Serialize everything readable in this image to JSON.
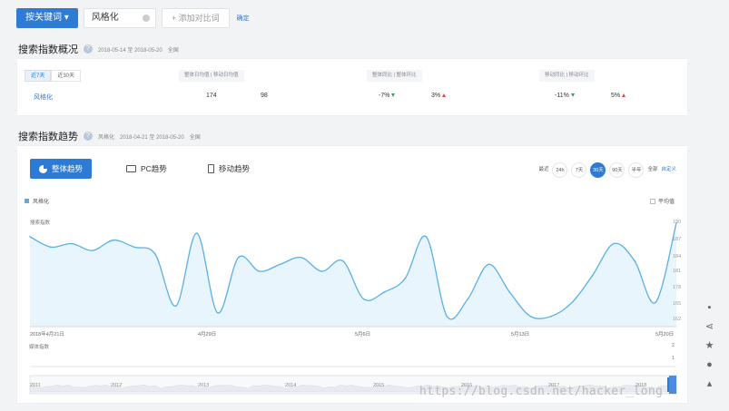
{
  "search_bar": {
    "keyword_button": "按关键词",
    "keyword_value": "风格化",
    "add_compare": "添加对比词",
    "confirm": "确定"
  },
  "overview": {
    "title": "搜索指数概况",
    "date_range": "2018-05-14 至 2018-05-20",
    "region": "全国",
    "tabs": [
      "近7天",
      "近30天"
    ],
    "headers": {
      "col1": "整体日均值  |  移动日均值",
      "col2": "整体同比  |  整体环比",
      "col3": "移动同比  |  移动环比"
    },
    "keyword": "风格化",
    "overall_daily_avg": "174",
    "mobile_daily_avg": "98",
    "overall_yoy": "-7%",
    "overall_mom": "3%",
    "mobile_yoy": "-11%",
    "mobile_mom": "5%"
  },
  "trend": {
    "title": "搜索指数趋势",
    "keyword": "风格化",
    "date_range": "2018-04-21 至 2018-05-20",
    "region": "全国",
    "tabs": [
      "整体趋势",
      "PC趋势",
      "移动趋势"
    ],
    "ranges": [
      "最近",
      "24h",
      "7天",
      "30天",
      "90天",
      "半年",
      "全部",
      "自定义"
    ],
    "active_range": "30天",
    "legend": "风格化",
    "avg_label": "平均值",
    "y_caption": "搜索指数",
    "media_caption": "媒体指数",
    "media_ticks": [
      "2",
      "1"
    ]
  },
  "chart_data": {
    "type": "area",
    "title": "",
    "xlabel": "",
    "ylabel": "搜索指数",
    "x_tick_labels": [
      "2018年4月21日",
      "4月29日",
      "5月6日",
      "5月13日",
      "5月20日"
    ],
    "y_tick_labels": [
      "190",
      "187",
      "184",
      "181",
      "178",
      "165",
      "162"
    ],
    "series": [
      {
        "name": "风格化",
        "values": [
          186,
          183,
          184,
          182,
          185,
          183,
          181,
          166,
          187,
          164,
          180,
          176,
          178,
          180,
          176,
          179,
          168,
          170,
          174,
          186,
          163,
          168,
          178,
          170,
          163,
          163,
          167,
          175,
          184,
          179,
          167,
          190
        ]
      }
    ],
    "brush_years": [
      "2011",
      "2012",
      "2013",
      "2014",
      "2015",
      "2016",
      "2017",
      "2018"
    ],
    "colors": {
      "line": "#5ab0e4",
      "fill": "#e9f5fc",
      "accent": "#2e7bd6"
    }
  },
  "side_tools": [
    "comment-icon",
    "share-icon",
    "star-icon",
    "help-icon",
    "top-icon"
  ],
  "watermark": "https://blog.csdn.net/hacker_long"
}
